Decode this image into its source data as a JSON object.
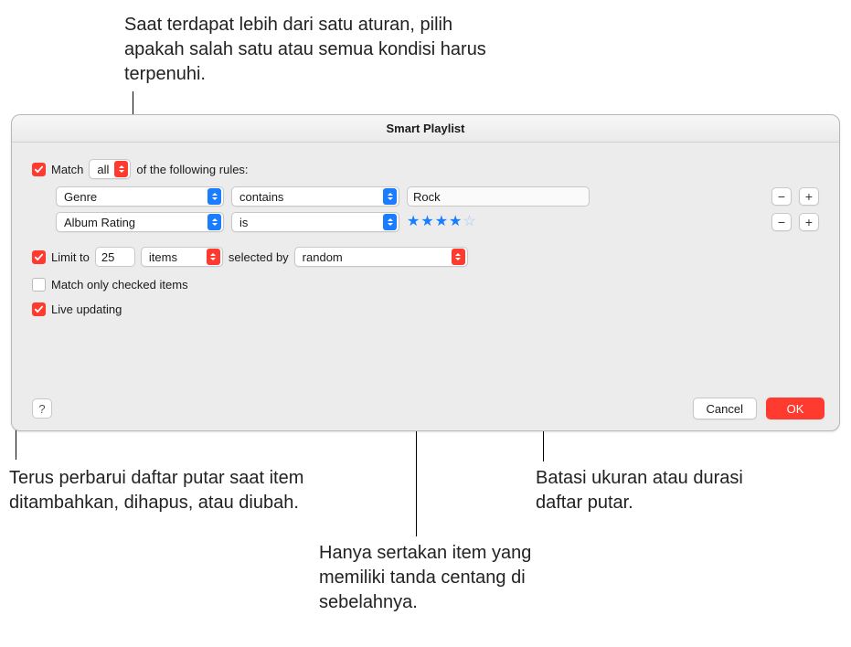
{
  "callouts": {
    "top": "Saat terdapat lebih dari satu aturan, pilih apakah salah satu atau semua kondisi harus terpenuhi.",
    "left": "Terus perbarui daftar putar saat item ditambahkan, dihapus, atau diubah.",
    "mid": "Hanya sertakan item yang memiliki tanda centang di sebelahnya.",
    "right": "Batasi ukuran atau durasi daftar putar."
  },
  "dialog": {
    "title": "Smart Playlist",
    "match": {
      "checkbox_checked": true,
      "prefix": "Match",
      "mode": "all",
      "suffix": "of the following rules:"
    },
    "rules": [
      {
        "field": "Genre",
        "operator": "contains",
        "value_type": "text",
        "value": "Rock"
      },
      {
        "field": "Album Rating",
        "operator": "is",
        "value_type": "stars",
        "value": 4,
        "max": 5
      }
    ],
    "limit": {
      "checked": true,
      "label": "Limit to",
      "count": "25",
      "unit": "items",
      "selected_by_label": "selected by",
      "selected_by": "random"
    },
    "match_only_checked": {
      "checked": false,
      "label": "Match only checked items"
    },
    "live_updating": {
      "checked": true,
      "label": "Live updating"
    },
    "buttons": {
      "help": "?",
      "cancel": "Cancel",
      "ok": "OK"
    }
  }
}
